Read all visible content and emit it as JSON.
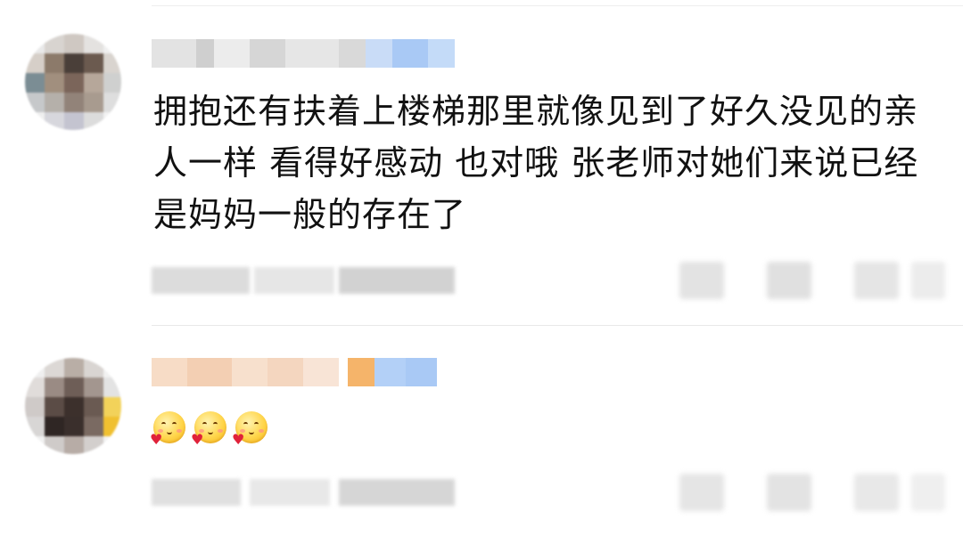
{
  "comments": [
    {
      "text": "拥抱还有扶着上楼梯那里就像见到了好久没见的亲人一样 看得好感动 也对哦 张老师对她们来说已经是妈妈一般的存在了",
      "avatar_icon": "user-avatar-icon",
      "username_blurred": true
    },
    {
      "emojis": [
        "love-emoji-icon",
        "love-emoji-icon",
        "love-emoji-icon"
      ],
      "avatar_icon": "user-avatar-icon",
      "username_blurred": true
    }
  ],
  "colors": {
    "text": "#111111",
    "divider": "#e8e8e8",
    "blur_gray": "#d9d9d9",
    "blur_blue": "#a9c9f5",
    "blur_orange": "#f5b46a"
  }
}
